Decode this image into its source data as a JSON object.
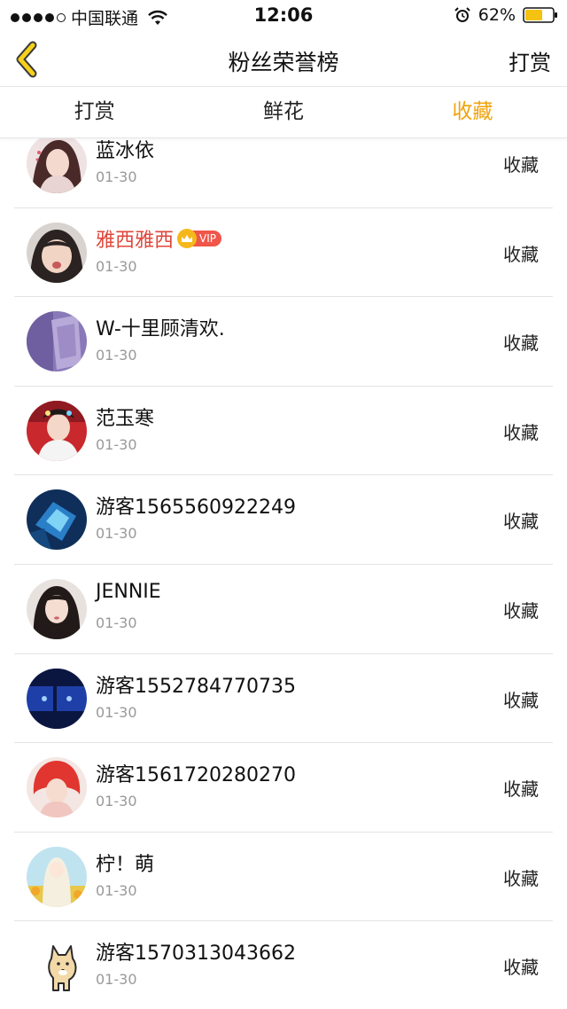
{
  "status_bar": {
    "carrier": "中国联通",
    "time": "12:06",
    "battery": "62%"
  },
  "nav": {
    "title": "粉丝荣誉榜",
    "action": "打赏"
  },
  "tabs": [
    {
      "label": "打赏",
      "active": false
    },
    {
      "label": "鲜花",
      "active": false
    },
    {
      "label": "收藏",
      "active": true
    }
  ],
  "accent_color": "#f0a30a",
  "vip_color": "#e0463a",
  "entries": [
    {
      "name": "蓝冰依",
      "date": "01-30",
      "action": "收藏"
    },
    {
      "name": "雅西雅西",
      "vip": "VIP",
      "date": "01-30",
      "action": "收藏"
    },
    {
      "name": "W-十里顾清欢.",
      "date": "01-30",
      "action": "收藏"
    },
    {
      "name": "范玉寒",
      "date": "01-30",
      "action": "收藏"
    },
    {
      "name": "游客1565560922249",
      "date": "01-30",
      "action": "收藏"
    },
    {
      "name": "JENNIE",
      "date": "01-30",
      "action": "收藏"
    },
    {
      "name": "游客1552784770735",
      "date": "01-30",
      "action": "收藏"
    },
    {
      "name": "游客1561720280270",
      "date": "01-30",
      "action": "收藏"
    },
    {
      "name": "柠！萌",
      "date": "01-30",
      "action": "收藏"
    },
    {
      "name": "游客1570313043662",
      "date": "01-30",
      "action": "收藏"
    }
  ]
}
